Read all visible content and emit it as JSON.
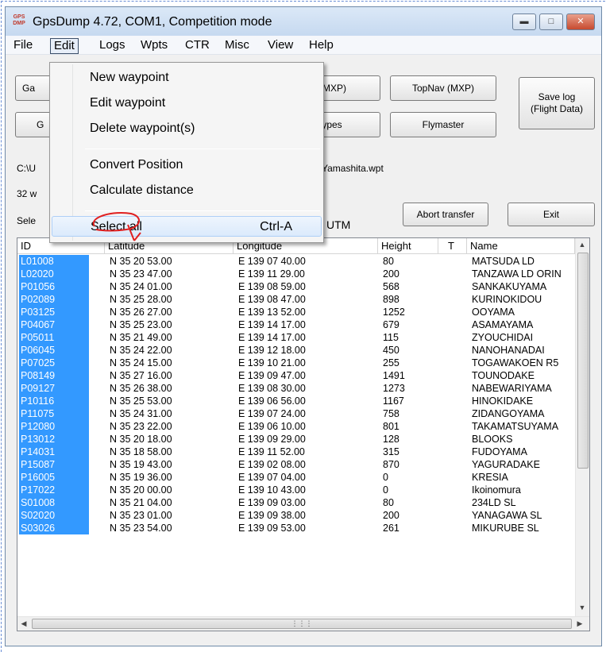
{
  "window": {
    "title": "GpsDump 4.72, COM1, Competition mode",
    "app_icon_text": "GPS DMP",
    "accent": "#3399ff"
  },
  "menubar": [
    "File",
    "Edit",
    "Logs",
    "Wpts",
    "CTR",
    "Misc",
    "View",
    "Help"
  ],
  "buttons": {
    "ga": "Ga",
    "g": "G",
    "flymaster_mxp": "er (MXP)",
    "topnav_mxp": "TopNav (MXP)",
    "save_log": "Save log (Flight Data)",
    "types": "types",
    "flymaster": "Flymaster",
    "abort": "Abort transfer",
    "exit": "Exit"
  },
  "info": {
    "path_left": "C:\\U",
    "path_right": "Yamashita.wpt",
    "count": "32 w",
    "select_left": "Sele",
    "utm": "UTM"
  },
  "edit_menu": {
    "items": [
      "New waypoint",
      "Edit waypoint",
      "Delete waypoint(s)",
      "Convert Position",
      "Calculate distance",
      "Select all"
    ],
    "select_all_shortcut": "Ctrl-A"
  },
  "table": {
    "headers": [
      "ID",
      "Latitude",
      "Longitude",
      "Height",
      "T",
      "Name"
    ],
    "rows": [
      [
        "L01008",
        "N 35 20 53.00",
        "E 139 07 40.00",
        "80",
        "",
        "MATSUDA LD"
      ],
      [
        "L02020",
        "N 35 23 47.00",
        "E 139 11 29.00",
        "200",
        "",
        "TANZAWA LD ORIN"
      ],
      [
        "P01056",
        "N 35 24 01.00",
        "E 139 08 59.00",
        "568",
        "",
        "SANKAKUYAMA"
      ],
      [
        "P02089",
        "N 35 25 28.00",
        "E 139 08 47.00",
        "898",
        "",
        "KURINOKIDOU"
      ],
      [
        "P03125",
        "N 35 26 27.00",
        "E 139 13 52.00",
        "1252",
        "",
        "OOYAMA"
      ],
      [
        "P04067",
        "N 35 25 23.00",
        "E 139 14 17.00",
        "679",
        "",
        "ASAMAYAMA"
      ],
      [
        "P05011",
        "N 35 21 49.00",
        "E 139 14 17.00",
        "115",
        "",
        "ZYOUCHIDAI"
      ],
      [
        "P06045",
        "N 35 24 22.00",
        "E 139 12 18.00",
        "450",
        "",
        "NANOHANADAI"
      ],
      [
        "P07025",
        "N 35 24 15.00",
        "E 139 10 21.00",
        "255",
        "",
        "TOGAWAKOEN R5"
      ],
      [
        "P08149",
        "N 35 27 16.00",
        "E 139 09 47.00",
        "1491",
        "",
        "TOUNODAKE"
      ],
      [
        "P09127",
        "N 35 26 38.00",
        "E 139 08 30.00",
        "1273",
        "",
        "NABEWARIYAMA"
      ],
      [
        "P10116",
        "N 35 25 53.00",
        "E 139 06 56.00",
        "1167",
        "",
        "HINOKIDAKE"
      ],
      [
        "P11075",
        "N 35 24 31.00",
        "E 139 07 24.00",
        "758",
        "",
        "ZIDANGOYAMA"
      ],
      [
        "P12080",
        "N 35 23 22.00",
        "E 139 06 10.00",
        "801",
        "",
        "TAKAMATSUYAMA"
      ],
      [
        "P13012",
        "N 35 20 18.00",
        "E 139 09 29.00",
        "128",
        "",
        "BLOOKS"
      ],
      [
        "P14031",
        "N 35 18 58.00",
        "E 139 11 52.00",
        "315",
        "",
        "FUDOYAMA"
      ],
      [
        "P15087",
        "N 35 19 43.00",
        "E 139 02 08.00",
        "870",
        "",
        "YAGURADAKE"
      ],
      [
        "P16005",
        "N 35 19 36.00",
        "E 139 07 04.00",
        "0",
        "",
        "KRESIA"
      ],
      [
        "P17022",
        "N 35 20 00.00",
        "E 139 10 43.00",
        "0",
        "",
        "Ikoinomura"
      ],
      [
        "S01008",
        "N 35 21 04.00",
        "E 139 09 03.00",
        "80",
        "",
        "234LD SL"
      ],
      [
        "S02020",
        "N 35 23 01.00",
        "E 139 09 38.00",
        "200",
        "",
        "YANAGAWA SL"
      ],
      [
        "S03026",
        "N 35 23 54.00",
        "E 139 09 53.00",
        "261",
        "",
        "MIKURUBE SL"
      ]
    ]
  }
}
